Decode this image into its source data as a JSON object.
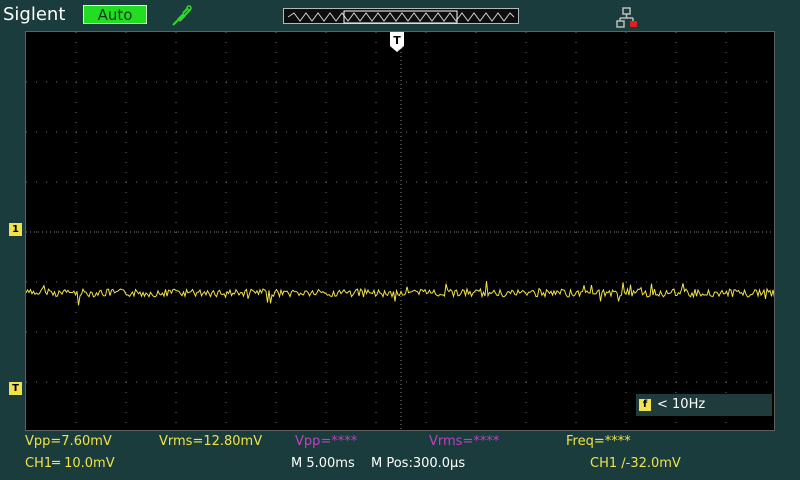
{
  "header": {
    "brand": "Siglent",
    "trigger_mode": "Auto",
    "probe_icon": "probe-icon",
    "network_icon": "network-icon"
  },
  "screen": {
    "trigger_marker": "T",
    "ch1_marker": "1",
    "trigger_level_marker": "T",
    "colors": {
      "ch1": "#f0e24a",
      "math": "#c040c0",
      "grid": "#7f7f7f"
    }
  },
  "freq_box": {
    "icon": "f",
    "text": "< 10Hz"
  },
  "measurements": {
    "vpp_ch1": "Vpp=7.60mV",
    "vrms_ch1": "Vrms=12.80mV",
    "vpp_ch2": "Vpp=****",
    "vrms_ch2": "Vrms=****",
    "freq": "Freq=****"
  },
  "status": {
    "ch1_scale": "CH1═ 10.0mV",
    "timebase": "M 5.00ms",
    "mpos": "M Pos:300.0µs",
    "trigger": "CH1 ∕-32.0mV"
  }
}
